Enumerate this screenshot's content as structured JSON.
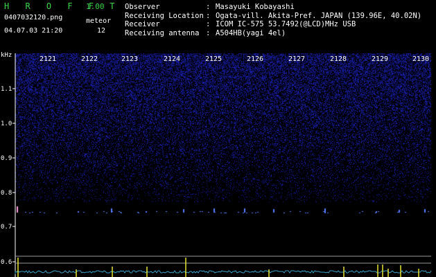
{
  "header": {
    "app_title": "H R O F F T",
    "app_version": "1.00",
    "file_name": "0407032120.png",
    "date_time": "04.07.03 21:20",
    "meteor_label": "meteor",
    "meteor_count": "12"
  },
  "info": [
    {
      "label": "Observer",
      "sep": ":",
      "value": "Masayuki Kobayashi"
    },
    {
      "label": "Receiving Location",
      "sep": ":",
      "value": "Ogata-vill. Akita-Pref. JAPAN (139.96E, 40.02N)"
    },
    {
      "label": "Receiver",
      "sep": ":",
      "value": "ICOM IC-575 53.7492(@LCD)MHz USB"
    },
    {
      "label": "Receiving antenna",
      "sep": ":",
      "value": "A504HB(yagi 4el)"
    }
  ],
  "spectrogram": {
    "unit": "kHz",
    "y_ticks": [
      "1.1",
      "1.0",
      "0.9",
      "0.8",
      "0.7",
      "0.6"
    ],
    "time_labels": [
      "2121",
      "2122",
      "2123",
      "2124",
      "2125",
      "2126",
      "2127",
      "2128",
      "2129",
      "2130"
    ],
    "colors": {
      "noise": "#1a1fb0",
      "echo": "#5a7dff",
      "echo_strong": "#ff9de0",
      "level": "#e6e632",
      "baseline": "#3aa0c8",
      "frame": "#ffffff"
    }
  }
}
